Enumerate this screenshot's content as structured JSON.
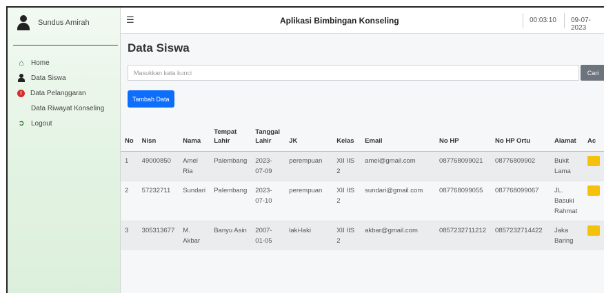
{
  "user": {
    "name": "Sundus Amirah"
  },
  "sidebar": {
    "items": [
      {
        "label": "Home",
        "icon": "home-icon"
      },
      {
        "label": "Data Siswa",
        "icon": "user-icon"
      },
      {
        "label": "Data Pelanggaran",
        "icon": "alert-icon"
      },
      {
        "label": "Data Riwayat Konseling",
        "icon": "list-icon"
      },
      {
        "label": "Logout",
        "icon": "logout-icon"
      }
    ]
  },
  "header": {
    "menu_icon": "hamburger-icon",
    "title": "Aplikasi Bimbingan Konseling",
    "time": "00:03:10",
    "date": "09-07-2023"
  },
  "main": {
    "page_title": "Data Siswa",
    "search": {
      "placeholder": "Masukkan kata kunci",
      "value": "",
      "button": "Cari"
    },
    "add_button": "Tambah Data",
    "table": {
      "columns": [
        {
          "key": "no",
          "label": "No"
        },
        {
          "key": "nisn",
          "label": "Nisn"
        },
        {
          "key": "nama",
          "label": "Nama"
        },
        {
          "key": "tempat_lahir",
          "label": "Tempat Lahir"
        },
        {
          "key": "tanggal_lahir",
          "label": "Tanggal Lahir"
        },
        {
          "key": "jk",
          "label": "JK"
        },
        {
          "key": "kelas",
          "label": "Kelas"
        },
        {
          "key": "email",
          "label": "Email"
        },
        {
          "key": "no_hp",
          "label": "No HP"
        },
        {
          "key": "no_hp_ortu",
          "label": "No HP Ortu"
        },
        {
          "key": "alamat",
          "label": "Alamat"
        },
        {
          "key": "aksi",
          "label": "Ac"
        }
      ],
      "rows": [
        {
          "no": "1",
          "nisn": "49000850",
          "nama": "Amel Ria",
          "tempat_lahir": "Palembang",
          "tanggal_lahir": "2023-07-09",
          "jk": "perempuan",
          "kelas": "XII IIS 2",
          "email": "amel@gmail.com",
          "no_hp": "087768099021",
          "no_hp_ortu": "08776809902",
          "alamat": "Bukit Lama",
          "aksi": "E"
        },
        {
          "no": "2",
          "nisn": "57232711",
          "nama": "Sundari",
          "tempat_lahir": "Palembang",
          "tanggal_lahir": "2023-07-10",
          "jk": "perempuan",
          "kelas": "XII IIS 2",
          "email": "sundari@gmail.com",
          "no_hp": "087768099055",
          "no_hp_ortu": "087768099067",
          "alamat": "JL. Basuki Rahmat",
          "aksi": "E"
        },
        {
          "no": "3",
          "nisn": "305313677",
          "nama": "M. Akbar",
          "tempat_lahir": "Banyu Asin",
          "tanggal_lahir": "2007-01-05",
          "jk": "laki-laki",
          "kelas": "XII IIS 2",
          "email": "akbar@gmail.com",
          "no_hp": "0857232711212",
          "no_hp_ortu": "0857232714422",
          "alamat": "Jaka Baring",
          "aksi": "E"
        }
      ]
    }
  },
  "colors": {
    "primary": "#0d6efd",
    "secondary": "#6c757d",
    "warning": "#f4c20d",
    "sidebar_bg": "#e3f3e3"
  }
}
